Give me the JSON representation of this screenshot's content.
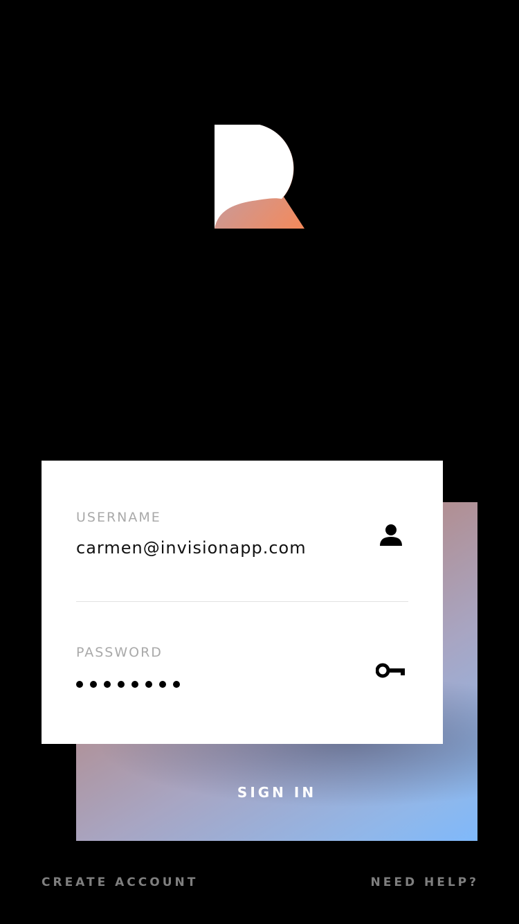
{
  "logo": {
    "name": "r-logo"
  },
  "form": {
    "username_label": "USERNAME",
    "username_value": "carmen@invisionapp.com",
    "password_label": "PASSWORD",
    "password_masked": "••••••••",
    "username_icon": "person-icon",
    "password_icon": "key-icon"
  },
  "actions": {
    "sign_in_label": "SIGN IN",
    "create_account_label": "CREATE ACCOUNT",
    "need_help_label": "NEED HELP?"
  },
  "colors": {
    "background": "#000000",
    "card": "#ffffff",
    "label": "#a9a9a9",
    "footer_link": "#7f7f7f",
    "logo_gradient_start": "#b0a3bc",
    "logo_gradient_end": "#f5895a",
    "gradient_start": "#c2918a",
    "gradient_end": "#7fb9fb"
  }
}
